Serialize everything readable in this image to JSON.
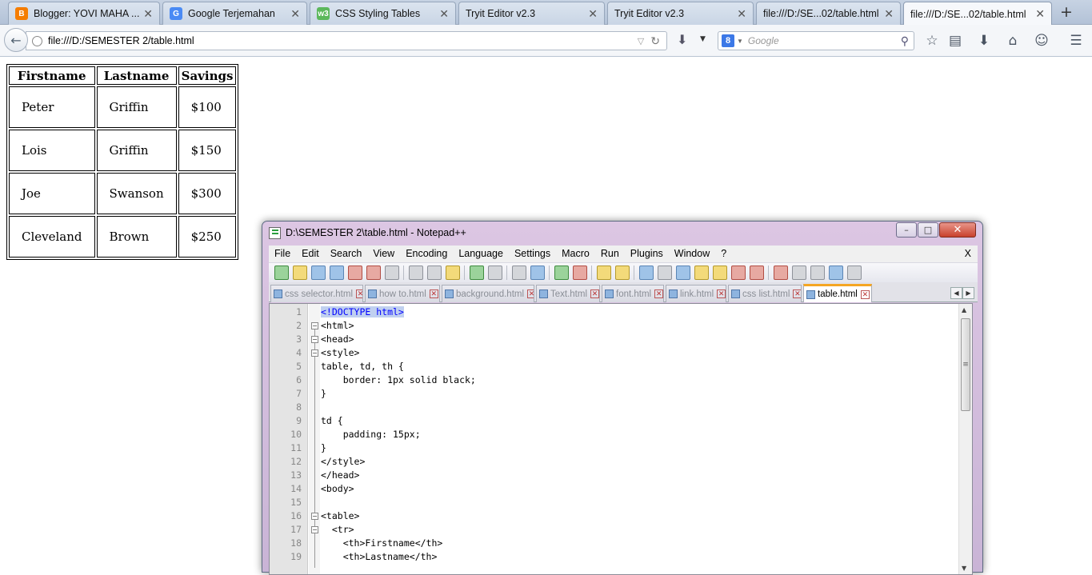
{
  "browser": {
    "tabs": [
      {
        "title": "Blogger: YOVI MAHA ...",
        "icon": "blogger-icon"
      },
      {
        "title": "Google Terjemahan",
        "icon": "google-translate-icon"
      },
      {
        "title": "CSS Styling Tables",
        "icon": "w3schools-icon"
      },
      {
        "title": "Tryit Editor v2.3",
        "icon": ""
      },
      {
        "title": "Tryit Editor v2.3",
        "icon": ""
      },
      {
        "title": "file:///D:/SE...02/table.html",
        "icon": ""
      },
      {
        "title": "file:///D:/SE...02/table.html",
        "icon": "",
        "active": true
      }
    ],
    "new_tab": "+",
    "url": "file:///D:/SEMESTER 2/table.html",
    "search_engine_badge": "8",
    "search_placeholder": "Google"
  },
  "page": {
    "headers": [
      "Firstname",
      "Lastname",
      "Savings"
    ],
    "rows": [
      [
        "Peter",
        "Griffin",
        "$100"
      ],
      [
        "Lois",
        "Griffin",
        "$150"
      ],
      [
        "Joe",
        "Swanson",
        "$300"
      ],
      [
        "Cleveland",
        "Brown",
        "$250"
      ]
    ]
  },
  "notepad": {
    "title": "D:\\SEMESTER 2\\table.html - Notepad++",
    "window_controls": [
      "–",
      "□",
      "✕"
    ],
    "menu": [
      "File",
      "Edit",
      "Search",
      "View",
      "Encoding",
      "Language",
      "Settings",
      "Macro",
      "Run",
      "Plugins",
      "Window",
      "?"
    ],
    "menu_close": "X",
    "file_tabs": [
      "css selector.html",
      "how to.html",
      "background.html",
      "Text.html",
      "font.html",
      "link.html",
      "css list.html",
      "table.html"
    ],
    "active_tab": "table.html",
    "tab_scroll": [
      "◀",
      "▶"
    ],
    "line_numbers": [
      "1",
      "2",
      "3",
      "4",
      "5",
      "6",
      "7",
      "8",
      "9",
      "10",
      "11",
      "12",
      "13",
      "14",
      "15",
      "16",
      "17",
      "18",
      "19"
    ],
    "code_lines": [
      "<!DOCTYPE html>",
      "<html>",
      "<head>",
      "<style>",
      "table, td, th {",
      "    border: 1px solid black;",
      "}",
      "",
      "td {",
      "    padding: 15px;",
      "}",
      "</style>",
      "</head>",
      "<body>",
      "",
      "<table>",
      "  <tr>",
      "    <th>Firstname</th>",
      "    <th>Lastname</th>"
    ],
    "syntax_colors": {
      "tag": "#0000ff",
      "text": "#000000",
      "highlight": "#c0d0f0"
    }
  },
  "colors": {
    "tab_active_accent": "#f5a623",
    "close_button": "#c8412c"
  }
}
